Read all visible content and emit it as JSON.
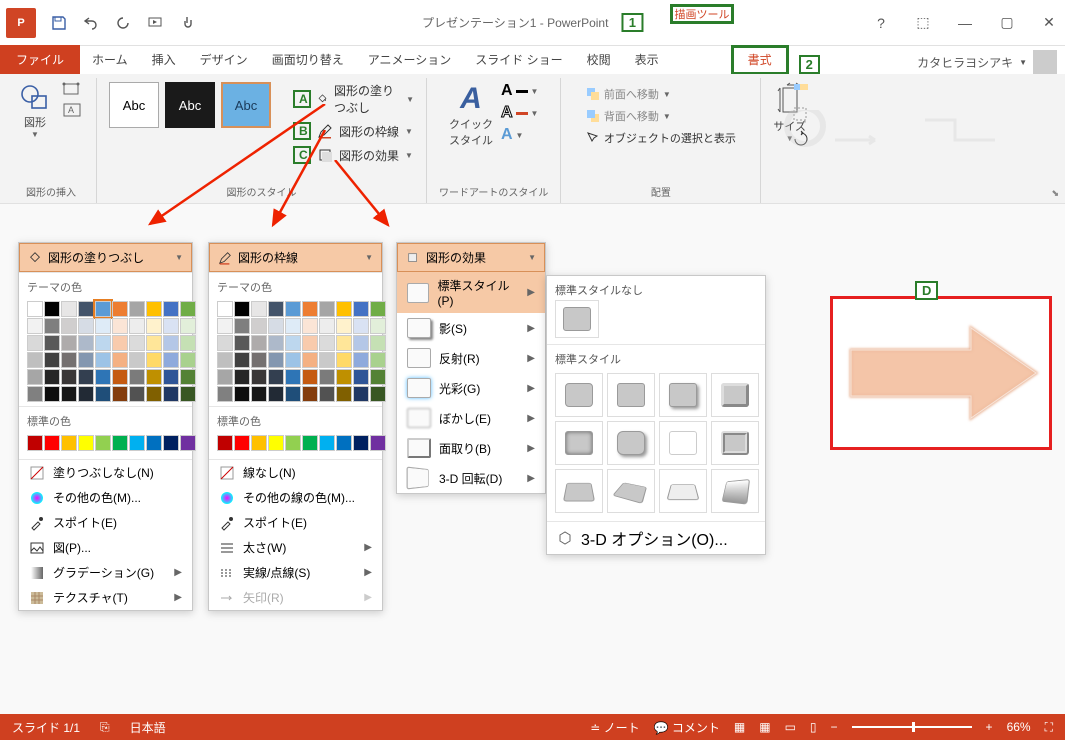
{
  "title": "プレゼンテーション1 - PowerPoint",
  "annotation": {
    "one": "1",
    "two": "2",
    "A": "A",
    "B": "B",
    "C": "C",
    "D": "D"
  },
  "drawing_tool": "描画ツール",
  "ribbon": {
    "file": "ファイル",
    "tabs": [
      "ホーム",
      "挿入",
      "デザイン",
      "画面切り替え",
      "アニメーション",
      "スライド ショー",
      "校閲",
      "表示"
    ],
    "format": "書式"
  },
  "user": "カタヒラヨシアキ",
  "groups": {
    "shapes": {
      "label": "図形",
      "title": "図形の挿入"
    },
    "styles": {
      "title": "図形のスタイル",
      "fill": "図形の塗りつぶし",
      "outline": "図形の枠線",
      "effects": "図形の効果",
      "abc": "Abc"
    },
    "wordart": {
      "quick": "クイック\nスタイル",
      "title": "ワードアートのスタイル"
    },
    "arrange": {
      "front": "前面へ移動",
      "back": "背面へ移動",
      "select": "オブジェクトの選択と表示",
      "title": "配置"
    },
    "size": {
      "label": "サイズ"
    }
  },
  "dropdown_fill": {
    "header": "図形の塗りつぶし",
    "theme": "テーマの色",
    "standard": "標準の色",
    "items": [
      "塗りつぶしなし(N)",
      "その他の色(M)...",
      "スポイト(E)",
      "図(P)...",
      "グラデーション(G)",
      "テクスチャ(T)"
    ]
  },
  "dropdown_outline": {
    "header": "図形の枠線",
    "theme": "テーマの色",
    "standard": "標準の色",
    "items": [
      "線なし(N)",
      "その他の線の色(M)...",
      "スポイト(E)",
      "太さ(W)",
      "実線/点線(S)",
      "矢印(R)"
    ]
  },
  "dropdown_effect": {
    "header": "図形の効果",
    "items": [
      "標準スタイル(P)",
      "影(S)",
      "反射(R)",
      "光彩(G)",
      "ぼかし(E)",
      "面取り(B)",
      "3-D 回転(D)"
    ]
  },
  "preset": {
    "none": "標準スタイルなし",
    "label": "標準スタイル",
    "option3d": "3-D オプション(O)..."
  },
  "theme_row1": [
    "#ffffff",
    "#000000",
    "#e7e6e6",
    "#44546a",
    "#5b9bd5",
    "#ed7d31",
    "#a5a5a5",
    "#ffc000",
    "#4472c4",
    "#70ad47"
  ],
  "theme_shades": [
    [
      "#f2f2f2",
      "#7f7f7f",
      "#d0cece",
      "#d6dce5",
      "#deebf7",
      "#fbe5d6",
      "#ededed",
      "#fff2cc",
      "#d9e2f3",
      "#e2efda"
    ],
    [
      "#d9d9d9",
      "#595959",
      "#aeabab",
      "#adb9ca",
      "#bdd7ee",
      "#f8cbad",
      "#dbdbdb",
      "#ffe699",
      "#b4c7e7",
      "#c5e0b4"
    ],
    [
      "#bfbfbf",
      "#404040",
      "#757171",
      "#8497b0",
      "#9dc3e6",
      "#f4b183",
      "#c9c9c9",
      "#ffd966",
      "#8faadc",
      "#a9d18e"
    ],
    [
      "#a6a6a6",
      "#262626",
      "#3b3838",
      "#333f50",
      "#2e75b6",
      "#c55a11",
      "#7b7b7b",
      "#bf9000",
      "#2f5597",
      "#548235"
    ],
    [
      "#808080",
      "#0d0d0d",
      "#171717",
      "#222a35",
      "#1f4e79",
      "#843c0c",
      "#525252",
      "#806000",
      "#203864",
      "#385723"
    ]
  ],
  "standard_colors": [
    "#c00000",
    "#ff0000",
    "#ffc000",
    "#ffff00",
    "#92d050",
    "#00b050",
    "#00b0f0",
    "#0070c0",
    "#002060",
    "#7030a0"
  ],
  "status": {
    "slide": "スライド 1/1",
    "lang": "日本語",
    "notes": "ノート",
    "comments": "コメント",
    "zoom": "66%"
  }
}
